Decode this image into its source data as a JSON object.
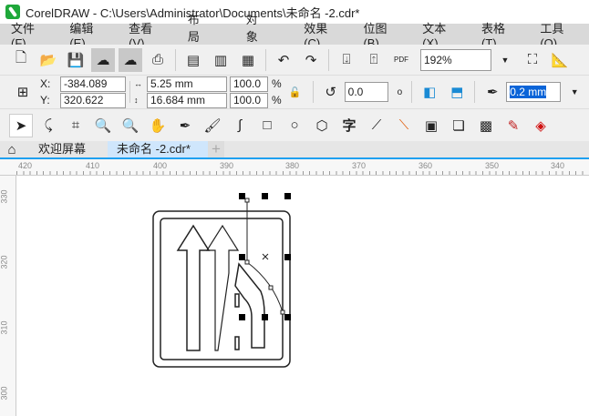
{
  "title": "CorelDRAW - C:\\Users\\Administrator\\Documents\\未命名 -2.cdr*",
  "menu": [
    "文件(F)",
    "编辑(E)",
    "查看(V)",
    "布局(L)",
    "对象(J)",
    "效果(C)",
    "位图(B)",
    "文本(X)",
    "表格(T)",
    "工具(O)"
  ],
  "toolbar": {
    "zoom": "192%",
    "pdf_label": "PDF"
  },
  "props": {
    "x_label": "X:",
    "y_label": "Y:",
    "x": "-384.089 mm",
    "y": "320.622 mm",
    "width": "5.25 mm",
    "height": "16.684 mm",
    "scale_x": "100.0",
    "scale_y": "100.0",
    "pct": "%",
    "rotation": "0.0",
    "degree": "o",
    "outline": "0.2 mm"
  },
  "tabs": {
    "welcome": "欢迎屏幕",
    "doc": "未命名 -2.cdr*",
    "add": "+"
  },
  "hruler": [
    "420",
    "410",
    "400",
    "390",
    "380",
    "370",
    "360",
    "350",
    "340"
  ],
  "vruler": [
    "330",
    "320",
    "310",
    "300"
  ]
}
